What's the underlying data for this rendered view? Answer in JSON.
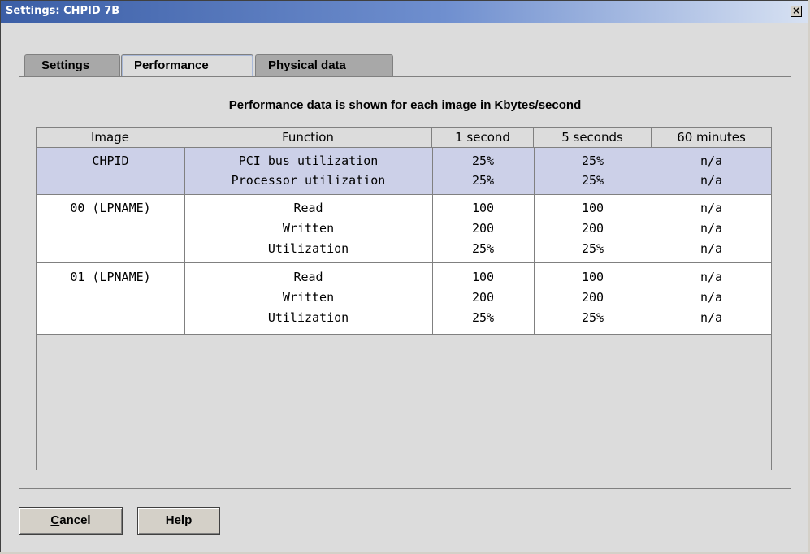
{
  "window": {
    "title": "Settings: CHPID 7B",
    "close_label": "×"
  },
  "tabs": [
    {
      "label": "Settings",
      "active": false
    },
    {
      "label": "Performance",
      "active": true
    },
    {
      "label": "Physical data",
      "active": false
    }
  ],
  "panel": {
    "heading": "Performance data is shown for each image in Kbytes/second",
    "columns": [
      "Image",
      "Function",
      "1 second",
      "5 seconds",
      "60 minutes"
    ],
    "groups": [
      {
        "image": "CHPID",
        "highlighted": true,
        "rows": [
          {
            "function": "PCI bus utilization",
            "s1": "25%",
            "s5": "25%",
            "m60": "n/a"
          },
          {
            "function": "Processor utilization",
            "s1": "25%",
            "s5": "25%",
            "m60": "n/a"
          }
        ]
      },
      {
        "image": "00 (LPNAME)",
        "highlighted": false,
        "rows": [
          {
            "function": "Read",
            "s1": "100",
            "s5": "100",
            "m60": "n/a"
          },
          {
            "function": "Written",
            "s1": "200",
            "s5": "200",
            "m60": "n/a"
          },
          {
            "function": "Utilization",
            "s1": "25%",
            "s5": "25%",
            "m60": "n/a"
          }
        ]
      },
      {
        "image": "01 (LPNAME)",
        "highlighted": false,
        "rows": [
          {
            "function": "Read",
            "s1": "100",
            "s5": "100",
            "m60": "n/a"
          },
          {
            "function": "Written",
            "s1": "200",
            "s5": "200",
            "m60": "n/a"
          },
          {
            "function": "Utilization",
            "s1": "25%",
            "s5": "25%",
            "m60": "n/a"
          }
        ]
      }
    ]
  },
  "buttons": {
    "cancel": {
      "mnemonic": "C",
      "rest": "ancel"
    },
    "help": {
      "label": "Help"
    }
  },
  "colors": {
    "selection_bg": "#ccd0e8",
    "row_bg": "#ffffff",
    "title_gradient_start": "#3b5ea6"
  }
}
